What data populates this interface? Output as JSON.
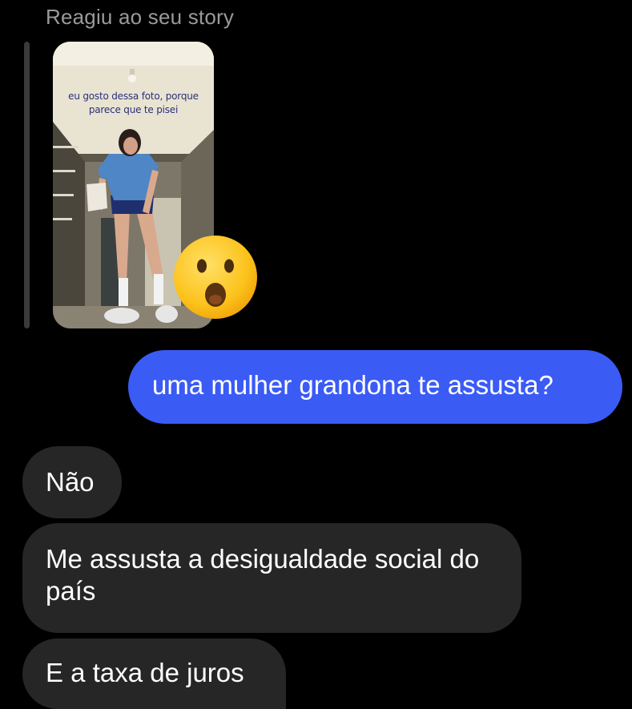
{
  "story_reply": {
    "header": "Reagiu ao seu story",
    "story_caption": "eu gosto dessa foto, porque parece que te pisei",
    "reaction_emoji": "face-with-open-mouth"
  },
  "messages": [
    {
      "sender": "me",
      "text": "uma mulher grandona te assusta?"
    },
    {
      "sender": "them",
      "text": "Não"
    },
    {
      "sender": "them",
      "text": "Me assusta a desigualdade social do país"
    },
    {
      "sender": "them",
      "text": "E a taxa de juros"
    }
  ],
  "colors": {
    "background": "#000000",
    "sent_bubble": "#3b5bf5",
    "received_bubble": "#262626",
    "header_text": "#9a9a9a"
  }
}
